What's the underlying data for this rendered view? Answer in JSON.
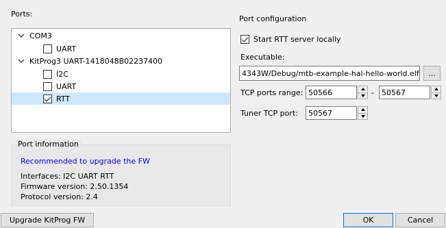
{
  "ports": {
    "label": "Ports:",
    "tree": [
      {
        "label": "COM3",
        "children": [
          {
            "label": "UART",
            "checked": false
          }
        ]
      },
      {
        "label": "KitProg3 UART-1418048B02237400",
        "children": [
          {
            "label": "I2C",
            "checked": false
          },
          {
            "label": "UART",
            "checked": false
          },
          {
            "label": "RTT",
            "checked": true,
            "selected": true
          }
        ]
      }
    ]
  },
  "port_information": {
    "title": "Port information",
    "warning": "Recommended to upgrade the FW",
    "warning_color": "#0000ff",
    "interfaces": "Interfaces: I2C UART RTT",
    "firmware": "Firmware version: 2.50.1354",
    "protocol": "Protocol version: 2.4"
  },
  "port_configuration": {
    "title": "Port configuration",
    "start_rtt_label": "Start RTT server locally",
    "start_rtt_checked": true,
    "executable_label": "Executable:",
    "executable_value": "4343W/Debug/mtb-example-hal-hello-world.elf",
    "browse_label": "...",
    "tcp_range_label": "TCP ports range:",
    "tcp_from": "50566",
    "range_sep": "-",
    "tcp_to": "50567",
    "tuner_label": "Tuner TCP port:",
    "tuner_value": "50567"
  },
  "footer": {
    "upgrade_label": "Upgrade KitProg FW",
    "ok_label": "OK",
    "cancel_label": "Cancel"
  }
}
